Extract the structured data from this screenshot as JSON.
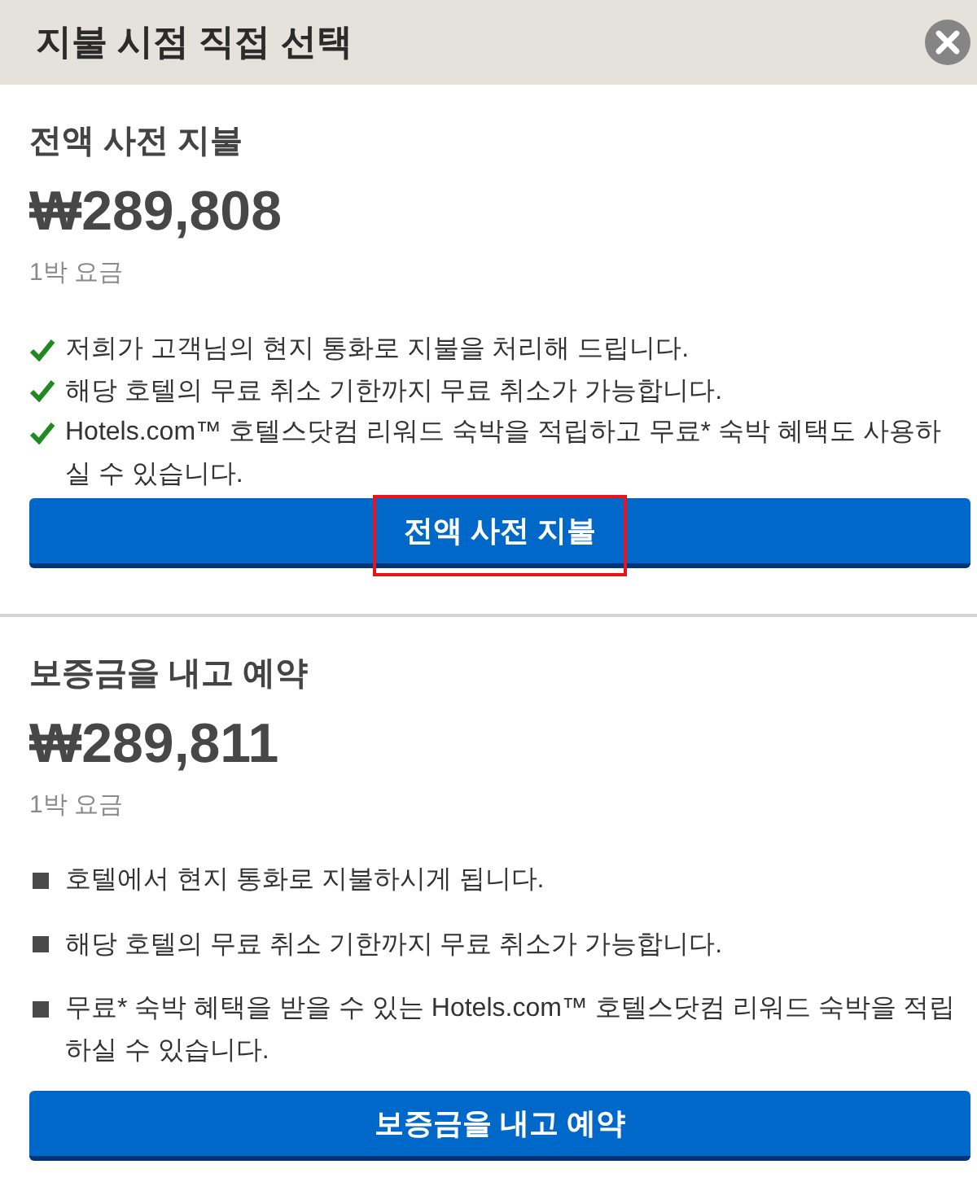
{
  "dialog": {
    "title": "지불 시점 직접 선택"
  },
  "sections": [
    {
      "kind": "check",
      "title": "전액 사전 지불",
      "price": "₩289,808",
      "price_note": "1박 요금",
      "benefits": [
        "저희가 고객님의 현지 통화로 지불을 처리해 드립니다.",
        "해당 호텔의 무료 취소 기한까지 무료 취소가 가능합니다.",
        "Hotels.com™ 호텔스닷컴 리워드 숙박을 적립하고 무료* 숙박 혜택도 사용하실 수 있습니다."
      ],
      "button": {
        "label": "전액 사전 지불",
        "highlighted": true
      }
    },
    {
      "kind": "square",
      "title": "보증금을 내고 예약",
      "price": "₩289,811",
      "price_note": "1박 요금",
      "benefits": [
        "호텔에서 현지 통화로 지불하시게 됩니다.",
        "해당 호텔의 무료 취소 기한까지 무료 취소가 가능합니다.",
        "무료* 숙박 혜택을 받을 수 있는 Hotels.com™ 호텔스닷컴 리워드 숙박을 적립하실 수 있습니다."
      ],
      "button": {
        "label": "보증금을 내고 예약",
        "highlighted": false
      }
    }
  ]
}
